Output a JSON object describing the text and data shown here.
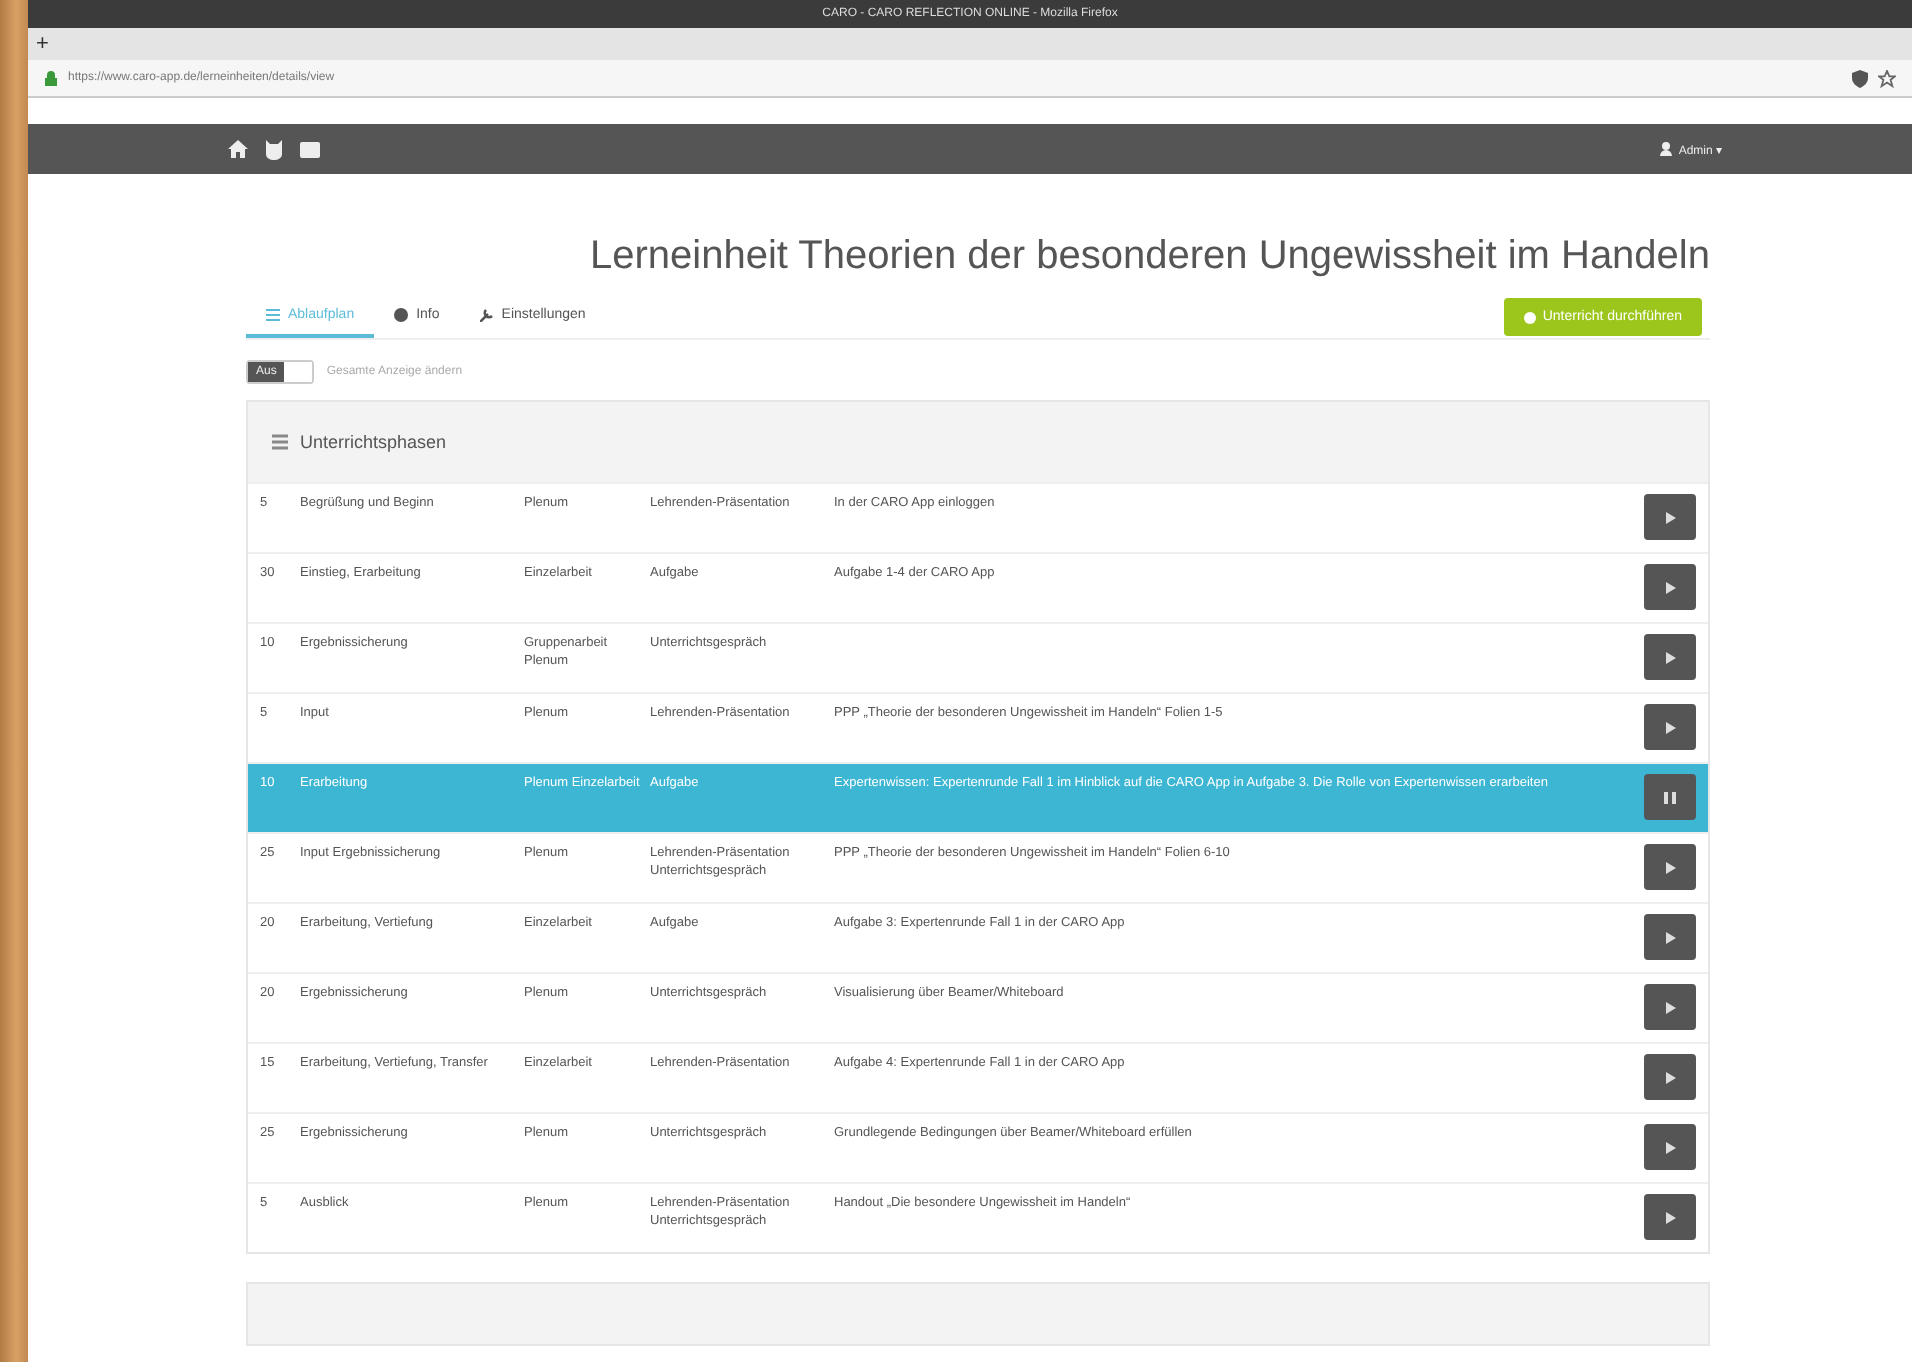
{
  "window": {
    "title": "CARO - CARO REFLECTION ONLINE - Mozilla Firefox"
  },
  "browser": {
    "new_tab": "+",
    "url": "https://www.caro-app.de/lerneinheiten/details/view"
  },
  "navbar": {
    "user": "Admin ▾"
  },
  "page": {
    "title": "Lerneinheit Theorien der besonderen Ungewissheit im Handeln"
  },
  "tabs": [
    {
      "label": "Ablaufplan",
      "selected": true
    },
    {
      "label": "Info",
      "selected": false
    },
    {
      "label": "Einstellungen",
      "selected": false
    }
  ],
  "action_button": "Unterricht durchführen",
  "toggle": {
    "label": "Aus",
    "on": false,
    "caption": "Gesamte Anzeige ändern"
  },
  "panel": {
    "title": "Unterrichtsphasen"
  },
  "rows": [
    {
      "minutes": "5",
      "phase": "Begrüßung und Beginn",
      "social_form": "Plenum",
      "medium": "Lehrenden-Präsentation",
      "description": "In der CARO App einloggen",
      "selected": false
    },
    {
      "minutes": "30",
      "phase": "Einstieg, Erarbeitung",
      "social_form": "Einzelarbeit",
      "medium": "Aufgabe",
      "description": "Aufgabe 1-4 der CARO App",
      "selected": false
    },
    {
      "minutes": "10",
      "phase": "Ergebnissicherung",
      "social_form": "Gruppenarbeit Plenum",
      "medium": "Unterrichtsgespräch",
      "description": "",
      "selected": false
    },
    {
      "minutes": "5",
      "phase": "Input",
      "social_form": "Plenum",
      "medium": "Lehrenden-Präsentation",
      "description": "PPP „Theorie der besonderen Ungewissheit im Handeln“ Folien 1-5",
      "selected": false
    },
    {
      "minutes": "10",
      "phase": "Erarbeitung",
      "social_form": "Plenum Einzelarbeit",
      "medium": "Aufgabe",
      "description": "Expertenwissen: Expertenrunde Fall 1 im Hinblick auf die CARO App in Aufgabe 3. Die Rolle von Expertenwissen erarbeiten",
      "selected": true
    },
    {
      "minutes": "25",
      "phase": "Input Ergebnissicherung",
      "social_form": "Plenum",
      "medium": "Lehrenden-Präsentation Unterrichtsgespräch",
      "description": "PPP „Theorie der besonderen Ungewissheit im Handeln“ Folien 6-10",
      "selected": false
    },
    {
      "minutes": "20",
      "phase": "Erarbeitung, Vertiefung",
      "social_form": "Einzelarbeit",
      "medium": "Aufgabe",
      "description": "Aufgabe 3: Expertenrunde Fall 1 in der CARO App",
      "selected": false
    },
    {
      "minutes": "20",
      "phase": "Ergebnissicherung",
      "social_form": "Plenum",
      "medium": "Unterrichtsgespräch",
      "description": "Visualisierung über Beamer/Whiteboard",
      "selected": false
    },
    {
      "minutes": "15",
      "phase": "Erarbeitung, Vertiefung, Transfer",
      "social_form": "Einzelarbeit",
      "medium": "Lehrenden-Präsentation",
      "description": "Aufgabe 4: Expertenrunde Fall 1 in der CARO App",
      "selected": false
    },
    {
      "minutes": "25",
      "phase": "Ergebnissicherung",
      "social_form": "Plenum",
      "medium": "Unterrichtsgespräch",
      "description": "Grundlegende Bedingungen über Beamer/Whiteboard erfüllen",
      "selected": false
    },
    {
      "minutes": "5",
      "phase": "Ausblick",
      "social_form": "Plenum",
      "medium": "Lehrenden-Präsentation Unterrichtsgespräch",
      "description": "Handout „Die besondere Ungewissheit im Handeln“",
      "selected": false
    }
  ]
}
